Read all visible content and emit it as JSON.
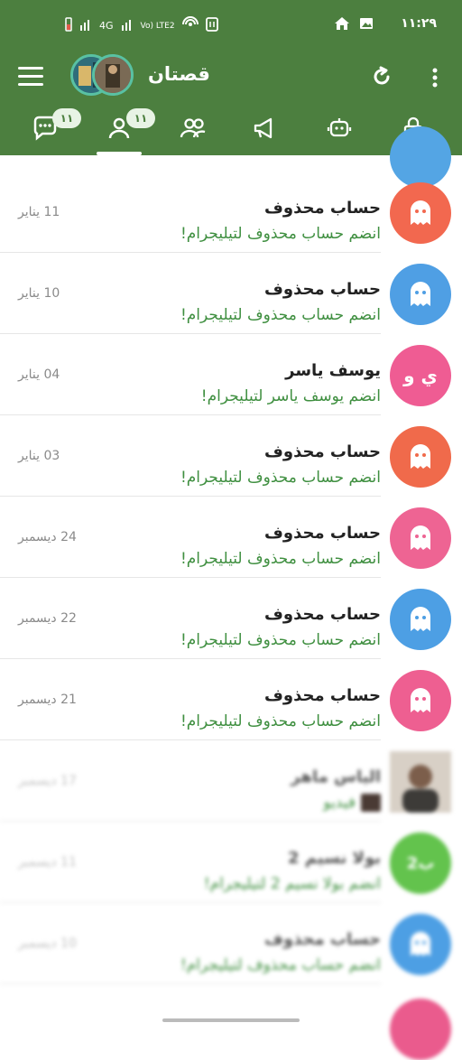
{
  "status_bar": {
    "time": "١١:٢٩",
    "network_label": "4G",
    "volte_label": "Vo) LTE2"
  },
  "app": {
    "title": "قصتان",
    "accent": "#4c7f3f"
  },
  "tabs": [
    {
      "name": "chats",
      "badge": "١١"
    },
    {
      "name": "contacts",
      "badge": "١١"
    },
    {
      "name": "groups",
      "badge": ""
    },
    {
      "name": "channels",
      "badge": ""
    },
    {
      "name": "bots",
      "badge": ""
    },
    {
      "name": "locked",
      "badge": ""
    }
  ],
  "chats": [
    {
      "name": "حساب محذوف",
      "preview": "انضم حساب محذوف لتيليجرام!",
      "date": "11 يناير",
      "avatar_color": "#f2684f",
      "avatar_icon": "ghost-icon"
    },
    {
      "name": "حساب محذوف",
      "preview": "انضم حساب محذوف لتيليجرام!",
      "date": "10 يناير",
      "avatar_color": "#4f9fe4",
      "avatar_icon": "ghost-icon"
    },
    {
      "name": "يوسف ياسر",
      "preview": "انضم يوسف ياسر لتيليجرام!",
      "date": "04 يناير",
      "avatar_color": "#ef5c93",
      "avatar_initials": "ي و"
    },
    {
      "name": "حساب محذوف",
      "preview": "انضم حساب محذوف لتيليجرام!",
      "date": "03 يناير",
      "avatar_color": "#f06a4b",
      "avatar_icon": "ghost-icon"
    },
    {
      "name": "حساب محذوف",
      "preview": "انضم حساب محذوف لتيليجرام!",
      "date": "24 ديسمبر",
      "avatar_color": "#ee6493",
      "avatar_icon": "ghost-icon"
    },
    {
      "name": "حساب محذوف",
      "preview": "انضم حساب محذوف لتيليجرام!",
      "date": "22 ديسمبر",
      "avatar_color": "#4d9fe4",
      "avatar_icon": "ghost-icon"
    },
    {
      "name": "حساب محذوف",
      "preview": "انضم حساب محذوف لتيليجرام!",
      "date": "21 ديسمبر",
      "avatar_color": "#ee5f91",
      "avatar_icon": "ghost-icon"
    },
    {
      "name": "الياس ماهر",
      "preview": "فيديو",
      "date": "17 ديسمبر",
      "avatar_color": "#a28b7a",
      "avatar_icon": "photo-avatar"
    },
    {
      "name": "بولا نسيم 2",
      "preview": "انضم بولا نسيم 2 لتيليجرام!",
      "date": "11 ديسمبر",
      "avatar_color": "#63c34d",
      "avatar_initials": "ب2"
    },
    {
      "name": "حساب محذوف",
      "preview": "انضم حساب محذوف لتيليجرام!",
      "date": "10 ديسمبر",
      "avatar_color": "#4d9fe4",
      "avatar_icon": "ghost-icon"
    }
  ]
}
